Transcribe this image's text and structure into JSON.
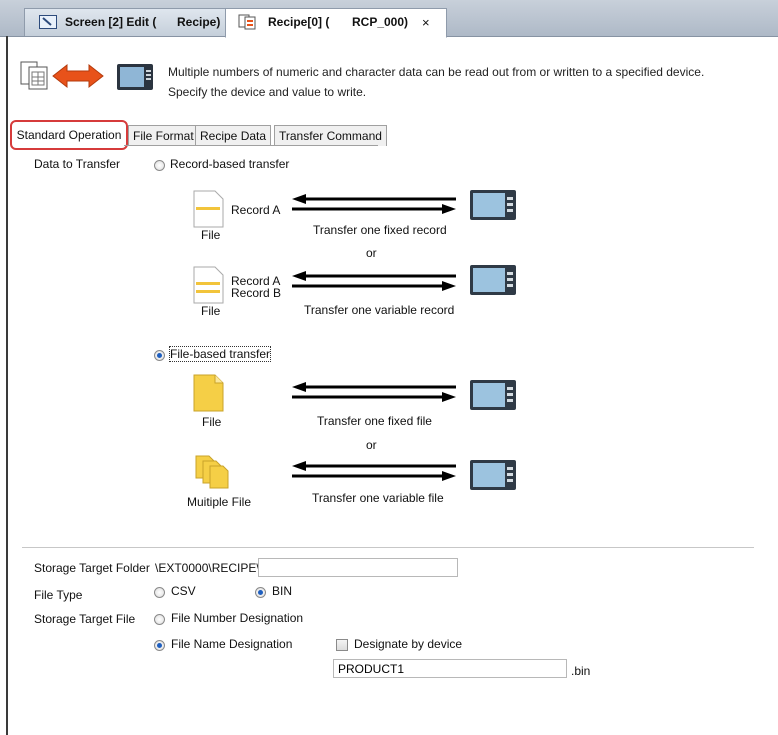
{
  "tabs": [
    {
      "label": "Screen [2] Edit (",
      "label2": "Recipe)"
    },
    {
      "label": "Recipe[0] (",
      "label2": "RCP_000)",
      "close": "×"
    }
  ],
  "header": {
    "line1": "Multiple numbers of numeric and character data can be read out from or written to a specified device.",
    "line2": "Specify the device and value to write."
  },
  "inner_tabs": [
    "Standard Operation",
    "File Format",
    "Recipe Data",
    "Transfer Command"
  ],
  "data_to_transfer": {
    "label": "Data to Transfer",
    "record_based": {
      "label": "Record-based transfer",
      "selected": false,
      "fixed": {
        "record": "Record A",
        "file": "File",
        "caption": "Transfer one fixed record"
      },
      "or": "or",
      "variable": {
        "record_a": "Record A",
        "record_b": "Record B",
        "file": "File",
        "caption": "Transfer one variable record"
      }
    },
    "file_based": {
      "label": "File-based transfer",
      "selected": true,
      "fixed": {
        "file": "File",
        "caption": "Transfer one fixed file"
      },
      "or": "or",
      "variable": {
        "file": "Muitiple File",
        "caption": "Transfer one variable file"
      }
    }
  },
  "storage": {
    "folder_label": "Storage Target Folder",
    "folder_value": "\\EXT0000\\RECIPE\\",
    "file_type_label": "File Type",
    "file_type_options": [
      {
        "label": "CSV",
        "selected": false
      },
      {
        "label": "BIN",
        "selected": true
      }
    ],
    "target_file_label": "Storage Target File",
    "number_designation": {
      "label": "File Number Designation",
      "selected": false
    },
    "name_designation": {
      "label": "File Name Designation",
      "selected": true
    },
    "designate_by_device": {
      "label": "Designate by device",
      "checked": false
    },
    "file_name": "PRODUCT1",
    "extension": ".bin"
  },
  "colors": {
    "accent_red": "#d63b3b",
    "arrow_orange": "#e8521a",
    "radio_blue": "#1f5fbf",
    "file_yellow": "#f5cf46"
  }
}
